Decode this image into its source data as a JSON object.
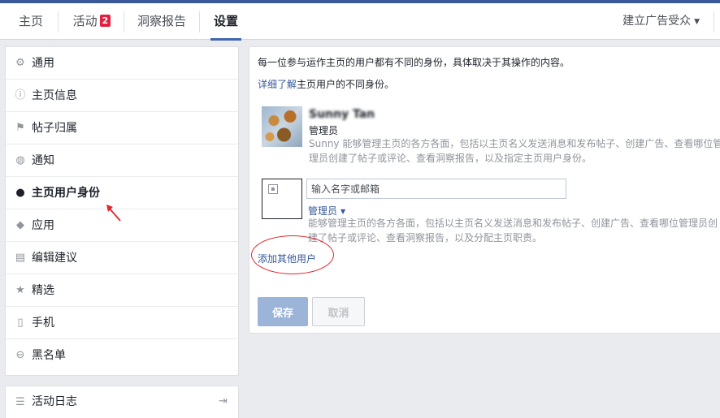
{
  "nav": {
    "tabs": [
      {
        "label": "主页"
      },
      {
        "label": "活动",
        "badge": "2"
      },
      {
        "label": "洞察报告"
      },
      {
        "label": "设置"
      }
    ],
    "right_label": "建立广告受众"
  },
  "sidebar": {
    "items": [
      {
        "label": "通用",
        "icon": "gear-icon"
      },
      {
        "label": "主页信息",
        "icon": "info-icon"
      },
      {
        "label": "帖子归属",
        "icon": "flag-icon"
      },
      {
        "label": "通知",
        "icon": "globe-icon"
      },
      {
        "label": "主页用户身份",
        "icon": "person-icon"
      },
      {
        "label": "应用",
        "icon": "cube-icon"
      },
      {
        "label": "编辑建议",
        "icon": "edit-icon"
      },
      {
        "label": "精选",
        "icon": "star-icon"
      },
      {
        "label": "手机",
        "icon": "phone-icon"
      },
      {
        "label": "黑名单",
        "icon": "block-icon"
      }
    ],
    "activity_log": {
      "label": "活动日志",
      "icon": "list-icon"
    }
  },
  "main": {
    "intro": "每一位参与运作主页的用户都有不同的身份，具体取决于其操作的内容。",
    "learn_link": "详细了解",
    "learn_rest": "主页用户的不同身份。",
    "existing_user": {
      "name": "Sunny Tan",
      "role": "管理员",
      "description": "Sunny 能够管理主页的各方各面，包括以主页名义发送消息和发布帖子、创建广告、查看哪位管理员创建了帖子或评论、查看洞察报告，以及指定主页用户身份。"
    },
    "new_user": {
      "input_placeholder": "输入名字或邮箱",
      "role": "管理员",
      "description": "能够管理主页的各方各面，包括以主页名义发送消息和发布帖子、创建广告、查看哪位管理员创建了帖子或评论、查看洞察报告，以及分配主页职责。"
    },
    "add_user_link": "添加其他用户",
    "save_label": "保存",
    "cancel_label": "取消"
  },
  "colors": {
    "accent": "#3b5998",
    "link": "#365899",
    "annotation": "#e0252b",
    "badge": "#e41e3f"
  }
}
